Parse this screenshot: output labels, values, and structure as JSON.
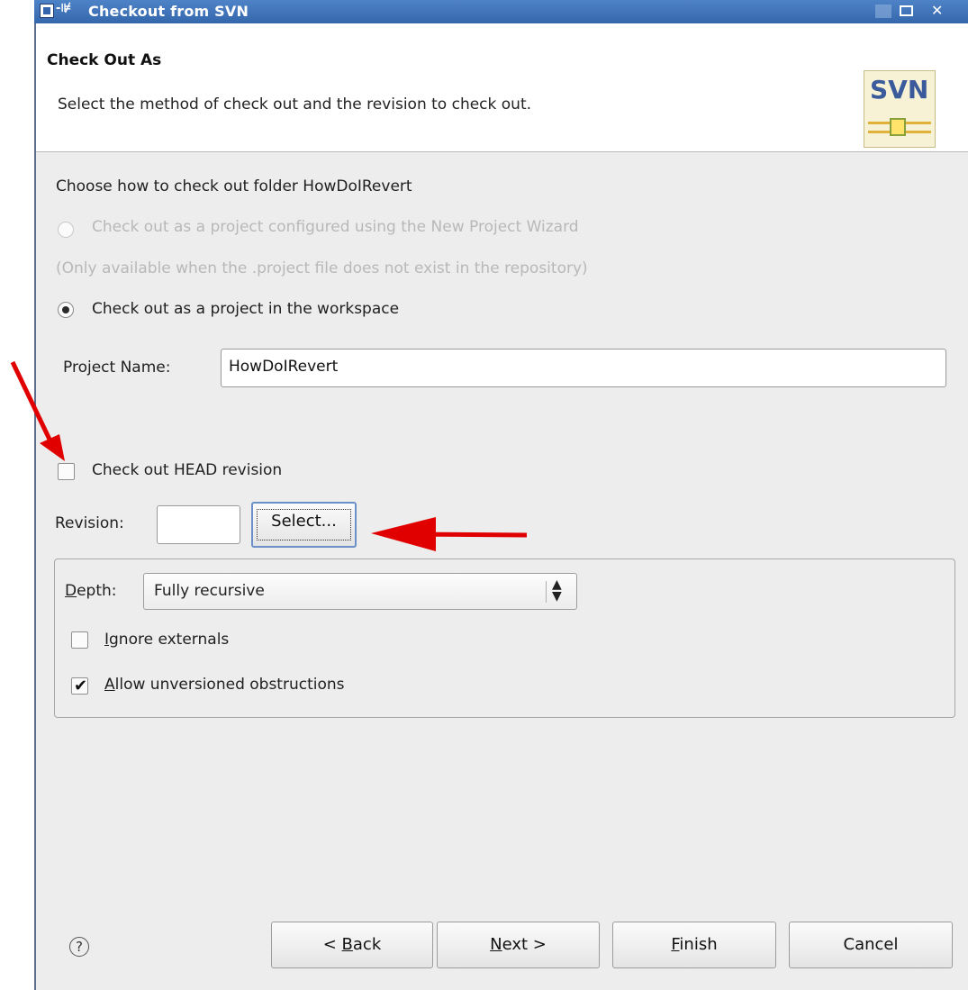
{
  "window": {
    "title": "Checkout from SVN",
    "pin_glyph": "-⊯"
  },
  "header": {
    "title": "Check Out As",
    "description": "Select the method of check out and the revision to check out.",
    "logo_text": "SVN"
  },
  "content": {
    "choose_label": "Choose how to check out folder HowDoIRevert",
    "option_wizard": "Check out as a project configured using the New Project Wizard",
    "option_wizard_note": "(Only available when the .project file does not exist in the repository)",
    "option_workspace": "Check out as a project in the workspace",
    "project_name_label": "Project Name:",
    "project_name_value": "HowDoIRevert",
    "head_revision_label": "Check out HEAD revision",
    "revision_label": "Revision:",
    "revision_value": "",
    "select_button": "Select..."
  },
  "depth_group": {
    "depth_label_prefix": "D",
    "depth_label_rest": "epth:",
    "depth_value": "Fully recursive",
    "ignore_prefix": "I",
    "ignore_rest": "gnore externals",
    "ignore_checked": false,
    "allow_prefix": "A",
    "allow_rest": "llow unversioned obstructions",
    "allow_checked": true
  },
  "footer": {
    "help_glyph": "?",
    "back_prefix": "< ",
    "back_mnemonic": "B",
    "back_rest": "ack",
    "next_mnemonic": "N",
    "next_rest": "ext >",
    "finish_mnemonic": "F",
    "finish_rest": "inish",
    "cancel": "Cancel"
  },
  "colors": {
    "titlebar": "#3566ad",
    "annotation_arrow": "#e00000",
    "disabled_text": "#b8b8b8"
  }
}
